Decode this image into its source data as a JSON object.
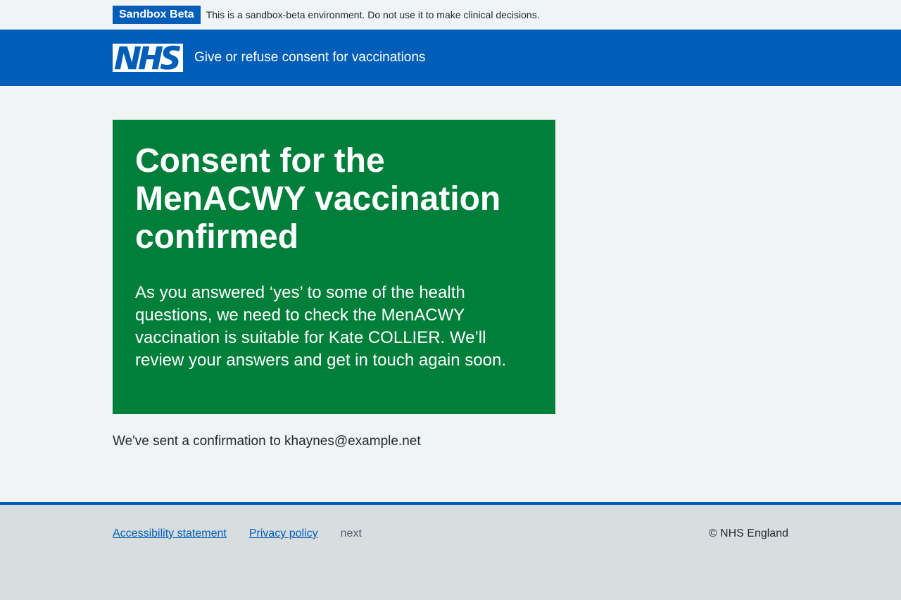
{
  "environment": {
    "tag": "Sandbox Beta",
    "message": "This is a sandbox-beta environment. Do not use it to make clinical decisions."
  },
  "header": {
    "logo_text": "NHS",
    "service_name": "Give or refuse consent for vaccinations"
  },
  "panel": {
    "title": "Consent for the MenACWY vaccination confirmed",
    "body": "As you answered ‘yes’ to some of the health questions, we need to check the MenACWY vaccination is suitable for Kate COLLIER. We’ll review your answers and get in touch again soon."
  },
  "confirmation": "We've sent a confirmation to khaynes@example.net",
  "footer": {
    "links": [
      {
        "label": "Accessibility statement"
      },
      {
        "label": "Privacy policy"
      }
    ],
    "version": "next",
    "copyright": "© NHS England"
  },
  "colors": {
    "brand_blue": "#005eb8",
    "panel_green": "#007f3b",
    "page_bg": "#f0f4f5",
    "footer_bg": "#d8dde0"
  }
}
